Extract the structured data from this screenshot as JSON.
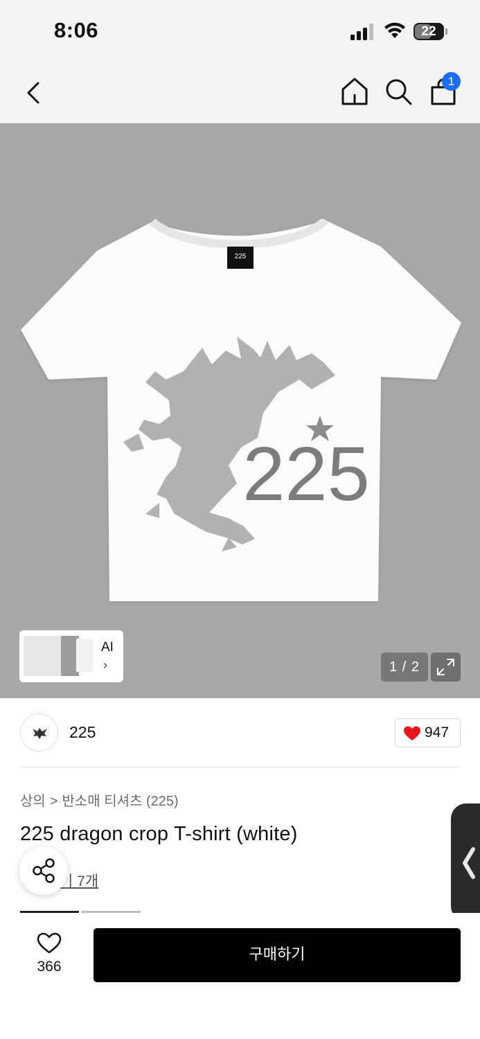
{
  "status_bar": {
    "time": "8:06",
    "battery": "22"
  },
  "header": {
    "cart_badge": "1",
    "icons": [
      "back-icon",
      "home-icon",
      "search-icon",
      "shopping-bag-icon"
    ]
  },
  "gallery": {
    "ai_label": "AI",
    "page_indicator": "1 / 2",
    "print_text": "225",
    "neck_label": "225"
  },
  "brand": {
    "name": "225",
    "likes": "947"
  },
  "product": {
    "breadcrumb": [
      "상의",
      "반소매 티셔츠 (225)"
    ],
    "breadcrumb_separator": ">",
    "title": "225 dragon crop T-shirt (white)",
    "review_link": "후기 7개",
    "review_link_visible": "기 7개"
  },
  "bottom_bar": {
    "wish_count": "366",
    "buy_label": "구매하기"
  },
  "colors": {
    "accent_blue": "#1b6ef3",
    "heart_red": "#e8161d",
    "gallery_bg": "#a8a8a8",
    "buy_bg": "#000000"
  }
}
